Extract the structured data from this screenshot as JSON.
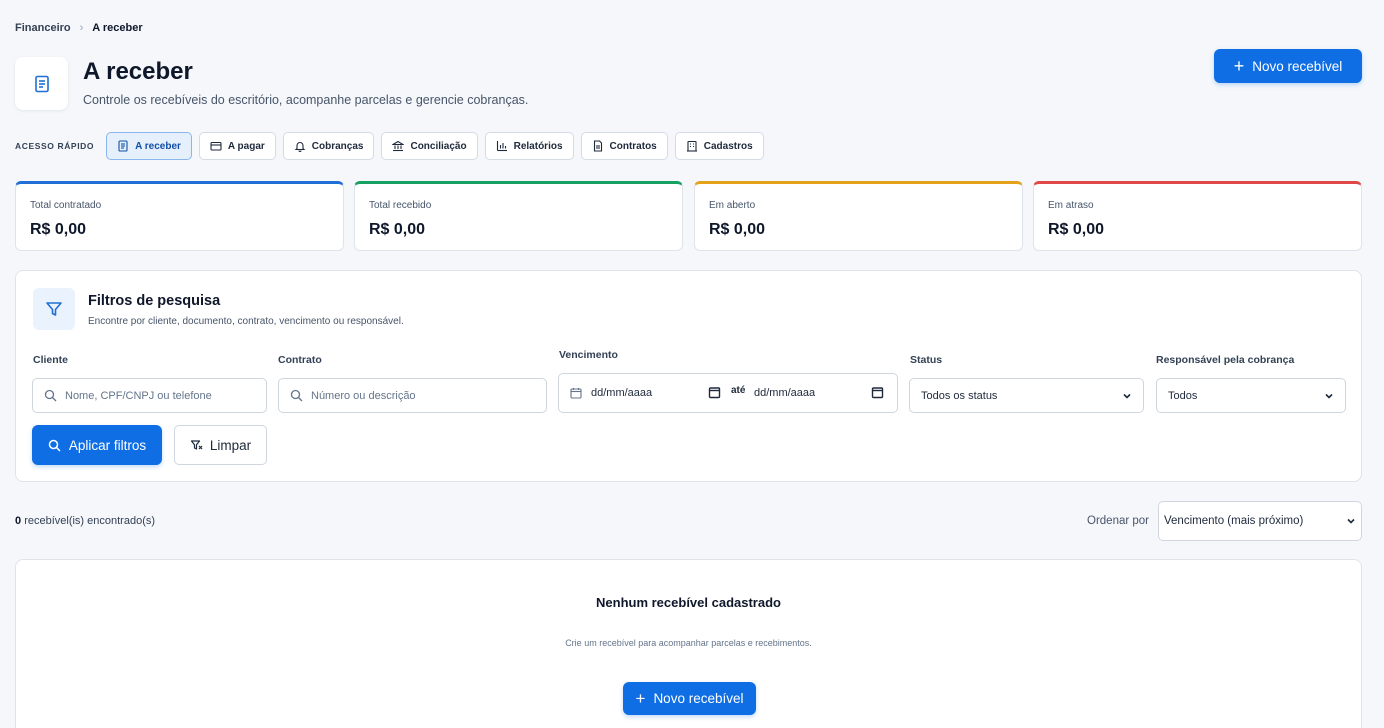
{
  "breadcrumb": {
    "parent": "Financeiro",
    "separator": "›",
    "current": "A receber"
  },
  "header": {
    "title": "A receber",
    "subtitle": "Controle os recebíveis do escritório, acompanhe parcelas e gerencie cobranças.",
    "new_button": "Novo recebível"
  },
  "quick_access": {
    "label": "ACESSO RÁPIDO",
    "items": [
      {
        "label": "A receber",
        "icon": "receipt-icon",
        "active": true
      },
      {
        "label": "A pagar",
        "icon": "wallet-icon",
        "active": false
      },
      {
        "label": "Cobranças",
        "icon": "bell-icon",
        "active": false
      },
      {
        "label": "Conciliação",
        "icon": "bank-icon",
        "active": false
      },
      {
        "label": "Relatórios",
        "icon": "bar-chart-icon",
        "active": false
      },
      {
        "label": "Contratos",
        "icon": "document-icon",
        "active": false
      },
      {
        "label": "Cadastros",
        "icon": "building-icon",
        "active": false
      }
    ]
  },
  "stats": [
    {
      "label": "Total contratado",
      "value": "R$ 0,00",
      "color": "#1f6fd6"
    },
    {
      "label": "Total recebido",
      "value": "R$ 0,00",
      "color": "#16a061"
    },
    {
      "label": "Em aberto",
      "value": "R$ 0,00",
      "color": "#e3a21a"
    },
    {
      "label": "Em atraso",
      "value": "R$ 0,00",
      "color": "#e04848"
    }
  ],
  "filters": {
    "title": "Filtros de pesquisa",
    "subtitle": "Encontre por cliente, documento, contrato, vencimento ou responsável.",
    "client": {
      "label": "Cliente",
      "placeholder": "Nome, CPF/CNPJ ou telefone"
    },
    "contract": {
      "label": "Contrato",
      "placeholder": "Número ou descrição"
    },
    "due": {
      "label": "Vencimento",
      "from_placeholder": "dd/mm/aaaa",
      "to_label": "até",
      "to_placeholder": "dd/mm/aaaa"
    },
    "status": {
      "label": "Status",
      "value": "Todos os status"
    },
    "responsible": {
      "label": "Responsável pela cobrança",
      "value": "Todos"
    },
    "apply_button": "Aplicar filtros",
    "clear_button": "Limpar"
  },
  "results": {
    "count": "0",
    "count_suffix": "recebível(is) encontrado(s)",
    "order_label": "Ordenar por",
    "order_value": "Vencimento (mais próximo)"
  },
  "empty_state": {
    "title": "Nenhum recebível cadastrado",
    "subtitle": "Crie um recebível para acompanhar parcelas e recebimentos.",
    "button": "Novo recebível"
  },
  "colors": {
    "primary": "#0f6ee4",
    "active_bg": "#e6f0fd"
  }
}
